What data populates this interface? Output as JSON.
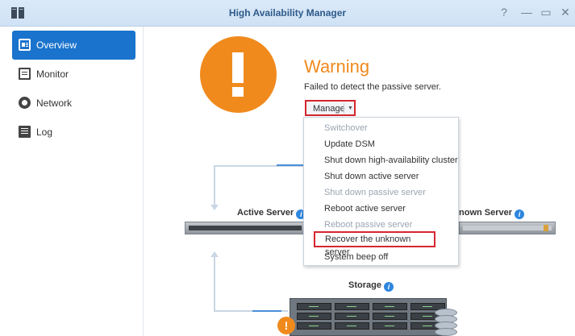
{
  "window": {
    "title": "High Availability Manager",
    "controls": [
      "?",
      "—",
      "▭",
      "✕"
    ]
  },
  "sidebar": {
    "items": [
      {
        "label": "Overview",
        "icon": "overview-icon",
        "active": true
      },
      {
        "label": "Monitor",
        "icon": "monitor-icon",
        "active": false
      },
      {
        "label": "Network",
        "icon": "network-icon",
        "active": false
      },
      {
        "label": "Log",
        "icon": "log-icon",
        "active": false
      }
    ]
  },
  "status": {
    "title": "Warning",
    "message": "Failed to detect the passive server.",
    "color": "#f08a1d"
  },
  "manage": {
    "label": "Manage",
    "menu": [
      {
        "label": "Switchover",
        "enabled": false
      },
      {
        "label": "Update DSM",
        "enabled": true
      },
      {
        "label": "Shut down high-availability cluster",
        "enabled": true
      },
      {
        "label": "Shut down active server",
        "enabled": true
      },
      {
        "label": "Shut down passive server",
        "enabled": false
      },
      {
        "label": "Reboot active server",
        "enabled": true
      },
      {
        "label": "Reboot passive server",
        "enabled": false
      },
      {
        "label": "Recover the unknown server",
        "enabled": true,
        "highlighted": true
      },
      {
        "label": "System beep off",
        "enabled": true
      }
    ]
  },
  "diagram": {
    "active_server_label": "Active Server",
    "unknown_server_label": "nown Server",
    "storage_label": "Storage"
  },
  "colors": {
    "accent": "#1a73cc",
    "warning": "#f08a1d",
    "highlight_border": "#d6262e"
  }
}
